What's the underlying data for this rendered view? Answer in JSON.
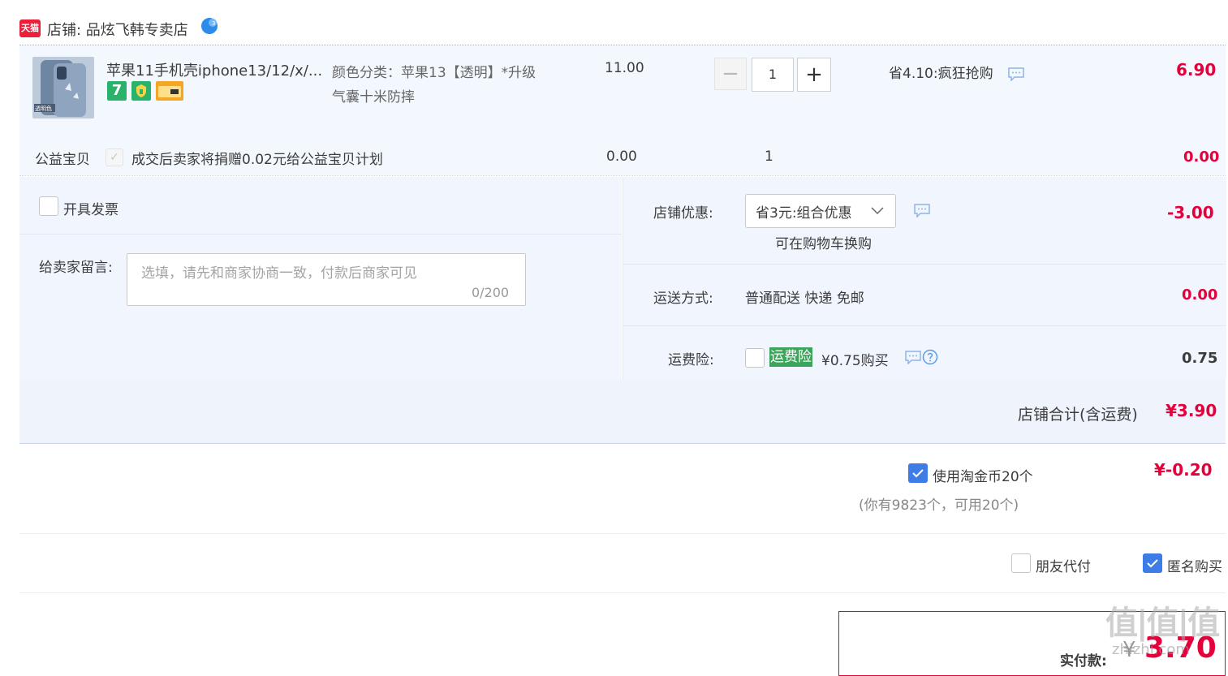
{
  "shop": {
    "logo_text": "天猫",
    "label": "店铺: 品炫飞韩专卖店"
  },
  "item": {
    "title": "苹果11手机壳iphone13/12/x/...",
    "sku_line1": "颜色分类：苹果13【透明】*升级",
    "sku_line2": "气囊十米防摔",
    "unit_price": "11.00",
    "quantity": "1",
    "minus": "−",
    "plus": "+",
    "promo": "省4.10:疯狂抢购",
    "total": "6.90",
    "badges": [
      "7",
      "shield",
      "card"
    ],
    "image_label": "透明色"
  },
  "charity": {
    "label": "公益宝贝",
    "desc": "成交后卖家将捐赠0.02元给公益宝贝计划",
    "price": "0.00",
    "qty": "1",
    "total": "0.00"
  },
  "options": {
    "invoice_label": "开具发票",
    "memo_label": "给卖家留言:",
    "memo_placeholder": "选填，请先和商家协商一致，付款后商家可见",
    "memo_count": "0/200"
  },
  "discount": {
    "label": "店铺优惠:",
    "value": "省3元:组合优惠",
    "note": "可在购物车换购",
    "amount": "-3.00"
  },
  "shipping": {
    "label": "运送方式:",
    "value": "普通配送 快递 免邮",
    "amount": "0.00"
  },
  "insurance": {
    "label": "运费险:",
    "tag": "运费险",
    "price": "¥0.75购买",
    "amount": "0.75"
  },
  "subtotal": {
    "label": "店铺合计(含运费)",
    "value": "¥3.90"
  },
  "coins": {
    "label": "使用淘金币20个",
    "amount": "¥-0.20",
    "note": "(你有9823个，可用20个)"
  },
  "payment": {
    "friend_label": "朋友代付",
    "anon_label": "匿名购买"
  },
  "final": {
    "label": "实付款:",
    "currency": "¥",
    "value": "3.70"
  },
  "watermark": {
    "text": "值|值|值",
    "sub": "zhizhi.com"
  },
  "colors": {
    "accent_red": "#e4003a",
    "check_blue": "#3e7de8",
    "tag_green": "#3aa55b",
    "panel_bg": "#f1f6fe"
  }
}
